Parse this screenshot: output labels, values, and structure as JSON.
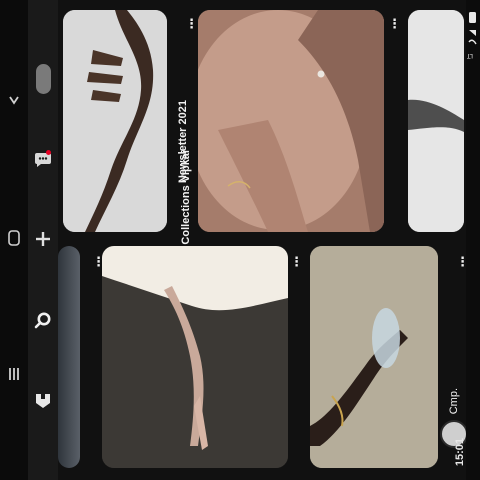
{
  "status_bar": {
    "time": "15:01"
  },
  "pins": [
    {
      "id": "pin-1",
      "caption": ""
    },
    {
      "id": "pin-2",
      "caption_line1": "Newsletter 2021",
      "caption_line2": "Collections Vipkai"
    },
    {
      "id": "pin-3",
      "caption": ""
    },
    {
      "id": "pin-4",
      "caption": ""
    },
    {
      "id": "pin-5",
      "caption": ""
    },
    {
      "id": "pin-6",
      "author": "Cmp."
    }
  ],
  "icons": {
    "home": "home-icon",
    "search": "search-icon",
    "create": "plus-icon",
    "messages": "chat-icon",
    "profile": "profile-icon"
  },
  "colors": {
    "background": "#111111",
    "nav_bg": "#1a1a1a",
    "notification_dot": "#e60023"
  }
}
